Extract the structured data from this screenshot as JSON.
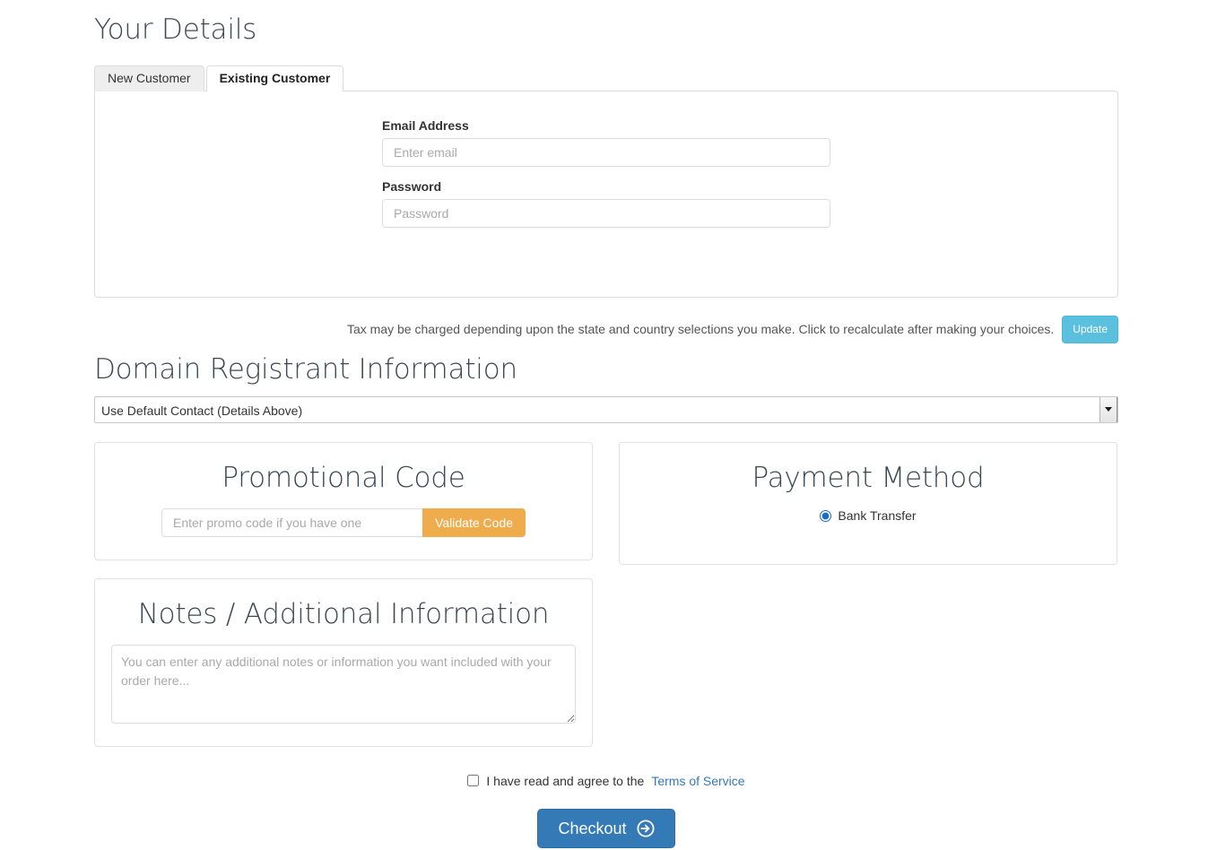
{
  "page": {
    "your_details_title": "Your Details",
    "registrant_title": "Domain Registrant Information"
  },
  "tabs": [
    {
      "label": "New Customer",
      "active": false
    },
    {
      "label": "Existing Customer",
      "active": true
    }
  ],
  "login_form": {
    "email_label": "Email Address",
    "email_placeholder": "Enter email",
    "email_value": "",
    "password_label": "Password",
    "password_placeholder": "Password",
    "password_value": ""
  },
  "tax_notice": {
    "text": "Tax may be charged depending upon the state and country selections you make. Click to recalculate after making your choices.",
    "update_label": "Update"
  },
  "registrant": {
    "selected_option": "Use Default Contact (Details Above)",
    "options": [
      "Use Default Contact (Details Above)"
    ],
    "dropdown_icon": "chevron-down-icon"
  },
  "promo": {
    "title": "Promotional Code",
    "placeholder": "Enter promo code if you have one",
    "value": "",
    "button_label": "Validate Code",
    "button_color": "#eeac4d"
  },
  "payment": {
    "title": "Payment Method",
    "methods": [
      {
        "label": "Bank Transfer",
        "selected": true
      }
    ]
  },
  "notes": {
    "title": "Notes / Additional Information",
    "placeholder": "You can enter any additional notes or information you want included with your order here...",
    "value": ""
  },
  "agreement": {
    "checked": false,
    "text": "I have read and agree to the",
    "link_label": "Terms of Service",
    "link_color": "#337ab7"
  },
  "checkout": {
    "label": "Checkout",
    "icon": "arrow-circle-right-icon",
    "color": "#337ab7"
  }
}
